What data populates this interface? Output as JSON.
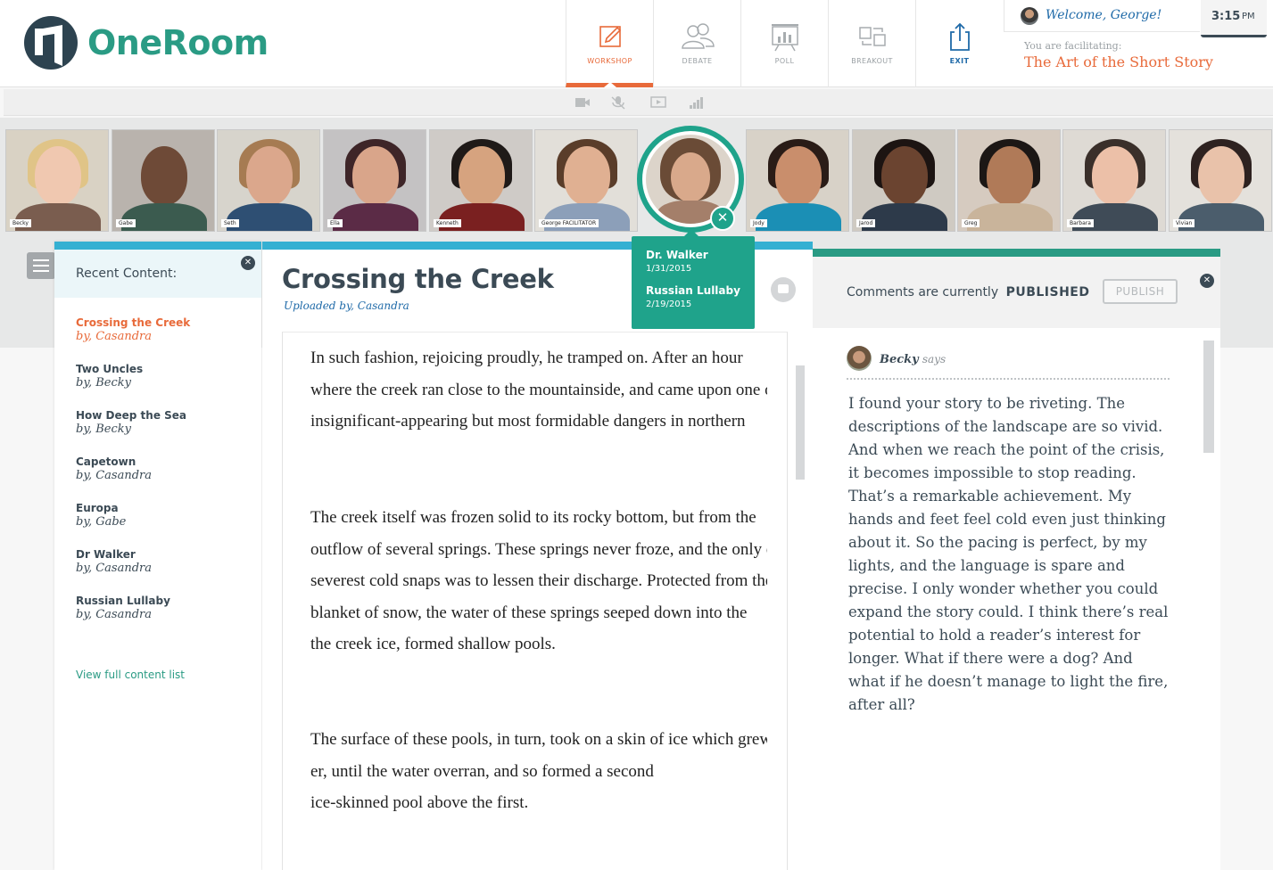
{
  "header": {
    "brand": "OneRoom",
    "welcome": "Welcome, George!",
    "time": "3:15",
    "ampm": "PM",
    "facilitating_label": "You are facilitating:",
    "facilitating_title": "The Art of the Short Story"
  },
  "toolbar": {
    "workshop": "WORKSHOP",
    "debate": "DEBATE",
    "poll": "POLL",
    "breakout": "BREAKOUT",
    "exit": "EXIT"
  },
  "participants": [
    {
      "name": "Becky"
    },
    {
      "name": "Gabe"
    },
    {
      "name": "Seth"
    },
    {
      "name": "Ella"
    },
    {
      "name": "Kenneth"
    },
    {
      "name": "George FACILITATOR"
    },
    {
      "name": "Jody"
    },
    {
      "name": "Jarod"
    },
    {
      "name": "Greg"
    },
    {
      "name": "Barbara"
    },
    {
      "name": "Vivian"
    }
  ],
  "popover": {
    "items": [
      {
        "title": "Dr. Walker",
        "date": "1/31/2015"
      },
      {
        "title": "Russian Lullaby",
        "date": "2/19/2015"
      }
    ]
  },
  "recent": {
    "title": "Recent Content:",
    "items": [
      {
        "title": "Crossing the Creek",
        "author": "by, Casandra"
      },
      {
        "title": "Two Uncles",
        "author": "by, Becky"
      },
      {
        "title": "How Deep the Sea",
        "author": "by, Becky"
      },
      {
        "title": "Capetown",
        "author": "by, Casandra"
      },
      {
        "title": "Europa",
        "author": "by, Gabe"
      },
      {
        "title": "Dr Walker",
        "author": "by, Casandra"
      },
      {
        "title": "Russian Lullaby",
        "author": "by, Casandra"
      }
    ],
    "full_list": "View full content list"
  },
  "document": {
    "title": "Crossing the Creek",
    "uploader": "Uploaded by, Casandra",
    "paragraphs": [
      [
        "In such fashion, rejoicing proudly, he tramped on. After an hour",
        "where the creek ran close to the mountainside, and came upon one of the",
        "insignificant-appearing but most formidable dangers in northern"
      ],
      [
        "The creek itself was frozen solid to its rocky bottom, but from the",
        "outflow of several springs. These springs never froze, and the only effect of the",
        "severest cold snaps was to lessen their discharge. Protected from the",
        "blanket of snow, the water of these springs seeped down into the",
        "the creek ice, formed shallow pools."
      ],
      [
        "The surface of these pools, in turn, took on a skin of ice which grew thick",
        "er, until the water overran, and so formed a second",
        "ice-skinned pool above the first."
      ]
    ]
  },
  "comments": {
    "status_label": "Comments are currently",
    "status_value": "PUBLISHED",
    "publish_label": "PUBLISH",
    "author": "Becky",
    "says": "says",
    "body": "I found your story to be riveting. The descriptions of the landscape are so vivid. And when we reach the point of the crisis, it becomes impossible to stop reading. That’s a remarkable achievement. My hands and feet feel cold even just thinking about it. So the pacing is perfect, by my lights, and the language is spare and precise. I only wonder whether you could expand the story could. I think there’s real potential to hold a reader’s interest for longer. What if there were a dog? And what if he doesn’t manage to light the fire, after all?"
  },
  "colors": {
    "brand_teal": "#2a9b84",
    "accent_orange": "#e86a3a",
    "link_blue": "#1f6aa8",
    "doc_bar_blue": "#35b0d2",
    "spotlight_green": "#1fa38b"
  }
}
